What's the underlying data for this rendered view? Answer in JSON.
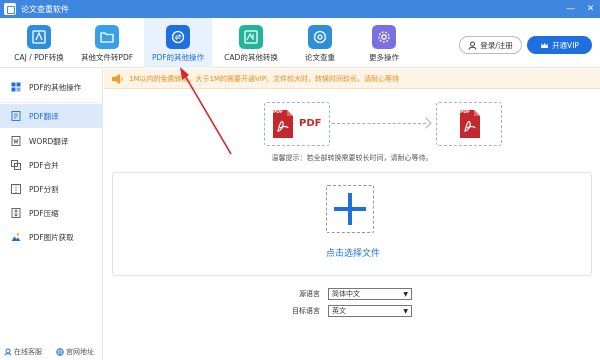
{
  "app": {
    "title": "论文查重软件"
  },
  "toolbar": {
    "tools": [
      {
        "label": "CAJ / PDF转换",
        "icon": "pdf-caj-icon"
      },
      {
        "label": "其他文件转PDF",
        "icon": "folder-icon"
      },
      {
        "label": "PDF的其他操作",
        "icon": "pdf-refresh-icon"
      },
      {
        "label": "CAD的其他转换",
        "icon": "cad-icon"
      },
      {
        "label": "论文查重",
        "icon": "at-icon"
      },
      {
        "label": "更多操作",
        "icon": "gear-icon"
      }
    ],
    "login_label": "登录/注册",
    "vip_label": "开通VIP"
  },
  "sidebar": {
    "header": "PDF的其他操作",
    "items": [
      {
        "label": "PDF翻译",
        "icon": "pdf-translate-icon"
      },
      {
        "label": "WORD翻译",
        "icon": "word-translate-icon"
      },
      {
        "label": "PDF合并",
        "icon": "merge-icon"
      },
      {
        "label": "PDF分割",
        "icon": "split-icon"
      },
      {
        "label": "PDF压缩",
        "icon": "compress-icon"
      },
      {
        "label": "PDF图片获取",
        "icon": "image-icon"
      }
    ],
    "footer": {
      "online_service": "在线客服",
      "website": "官网地址"
    }
  },
  "notice": {
    "text": "1M以内的免费转换，大于1M的需要开通VIP。文件较大时，转换时间较长，请耐心等待"
  },
  "illustration": {
    "pdf_word": "PDF",
    "badge": "PDF"
  },
  "tip": {
    "text": "温馨提示：若全部转换需要较长时间，请耐心等待。"
  },
  "drop_zone": {
    "label": "点击选择文件"
  },
  "language": {
    "source_label": "源语言",
    "source_value": "简体中文",
    "target_label": "目标语言",
    "target_value": "英文"
  },
  "colors": {
    "accent": "#1e6fe0",
    "titlebar": "#3f86e0",
    "pdf_red": "#c4282f",
    "notice": "#f08a1c"
  }
}
